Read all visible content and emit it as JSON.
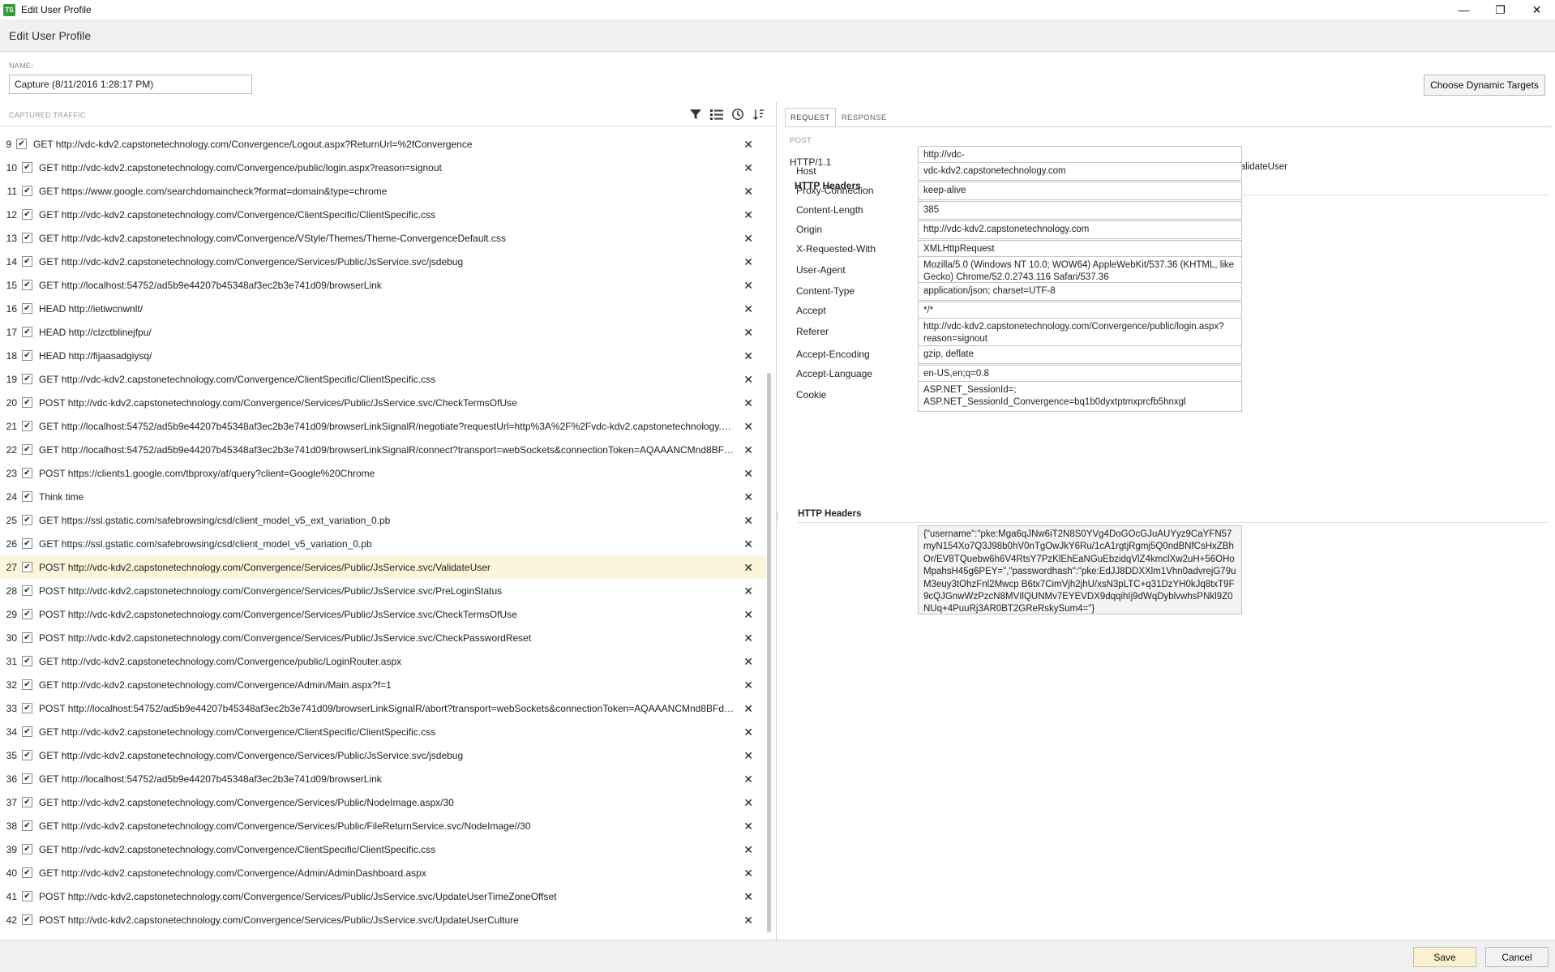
{
  "window": {
    "app_icon": "TS",
    "title": "Edit User Profile",
    "minimize_glyph": "—",
    "maximize_glyph": "❐",
    "close_glyph": "✕"
  },
  "header": {
    "title": "Edit User Profile"
  },
  "name": {
    "label": "NAME:",
    "value": "Capture (8/11/2016 1:28:17 PM)"
  },
  "dynamic_targets_button": "Choose Dynamic Targets",
  "traffic": {
    "title": "CAPTURED TRAFFIC",
    "toolbar_icons": [
      "filter-icon",
      "list-icon",
      "history-icon",
      "sort-icon"
    ],
    "rows": [
      {
        "num": "9",
        "text": "GET http://vdc-kdv2.capstonetechnology.com/Convergence/Logout.aspx?ReturnUrl=%2fConvergence"
      },
      {
        "num": "10",
        "text": "GET http://vdc-kdv2.capstonetechnology.com/Convergence/public/login.aspx?reason=signout"
      },
      {
        "num": "11",
        "text": "GET https://www.google.com/searchdomaincheck?format=domain&type=chrome"
      },
      {
        "num": "12",
        "text": "GET http://vdc-kdv2.capstonetechnology.com/Convergence/ClientSpecific/ClientSpecific.css"
      },
      {
        "num": "13",
        "text": "GET http://vdc-kdv2.capstonetechnology.com/Convergence/VStyle/Themes/Theme-ConvergenceDefault.css"
      },
      {
        "num": "14",
        "text": "GET http://vdc-kdv2.capstonetechnology.com/Convergence/Services/Public/JsService.svc/jsdebug"
      },
      {
        "num": "15",
        "text": "GET http://localhost:54752/ad5b9e44207b45348af3ec2b3e741d09/browserLink"
      },
      {
        "num": "16",
        "text": "HEAD http://ietiwcnwnlt/"
      },
      {
        "num": "17",
        "text": "HEAD http://clzctblinejfpu/"
      },
      {
        "num": "18",
        "text": "HEAD http://fijaasadgiysq/"
      },
      {
        "num": "19",
        "text": "GET http://vdc-kdv2.capstonetechnology.com/Convergence/ClientSpecific/ClientSpecific.css"
      },
      {
        "num": "20",
        "text": "POST http://vdc-kdv2.capstonetechnology.com/Convergence/Services/Public/JsService.svc/CheckTermsOfUse"
      },
      {
        "num": "21",
        "text": "GET http://localhost:54752/ad5b9e44207b45348af3ec2b3e741d09/browserLinkSignalR/negotiate?requestUrl=http%3A%2F%2Fvdc-kdv2.capstonetechnology.co..."
      },
      {
        "num": "22",
        "text": "GET http://localhost:54752/ad5b9e44207b45348af3ec2b3e741d09/browserLinkSignalR/connect?transport=webSockets&connectionToken=AQAAANCMnd8BFdE..."
      },
      {
        "num": "23",
        "text": "POST https://clients1.google.com/tbproxy/af/query?client=Google%20Chrome"
      },
      {
        "num": "24",
        "text": "Think time"
      },
      {
        "num": "25",
        "text": "GET https://ssl.gstatic.com/safebrowsing/csd/client_model_v5_ext_variation_0.pb"
      },
      {
        "num": "26",
        "text": "GET https://ssl.gstatic.com/safebrowsing/csd/client_model_v5_variation_0.pb"
      },
      {
        "num": "27",
        "text": "POST http://vdc-kdv2.capstonetechnology.com/Convergence/Services/Public/JsService.svc/ValidateUser"
      },
      {
        "num": "28",
        "text": "POST http://vdc-kdv2.capstonetechnology.com/Convergence/Services/Public/JsService.svc/PreLoginStatus"
      },
      {
        "num": "29",
        "text": "POST http://vdc-kdv2.capstonetechnology.com/Convergence/Services/Public/JsService.svc/CheckTermsOfUse"
      },
      {
        "num": "30",
        "text": "POST http://vdc-kdv2.capstonetechnology.com/Convergence/Services/Public/JsService.svc/CheckPasswordReset"
      },
      {
        "num": "31",
        "text": "GET http://vdc-kdv2.capstonetechnology.com/Convergence/public/LoginRouter.aspx"
      },
      {
        "num": "32",
        "text": "GET http://vdc-kdv2.capstonetechnology.com/Convergence/Admin/Main.aspx?f=1"
      },
      {
        "num": "33",
        "text": "POST http://localhost:54752/ad5b9e44207b45348af3ec2b3e741d09/browserLinkSignalR/abort?transport=webSockets&connectionToken=AQAAANCMnd8BFdER..."
      },
      {
        "num": "34",
        "text": "GET http://vdc-kdv2.capstonetechnology.com/Convergence/ClientSpecific/ClientSpecific.css"
      },
      {
        "num": "35",
        "text": "GET http://vdc-kdv2.capstonetechnology.com/Convergence/Services/Public/JsService.svc/jsdebug"
      },
      {
        "num": "36",
        "text": "GET http://localhost:54752/ad5b9e44207b45348af3ec2b3e741d09/browserLink"
      },
      {
        "num": "37",
        "text": "GET http://vdc-kdv2.capstonetechnology.com/Convergence/Services/Public/NodeImage.aspx/30"
      },
      {
        "num": "38",
        "text": "GET http://vdc-kdv2.capstonetechnology.com/Convergence/Services/Public/FileReturnService.svc/NodeImage//30"
      },
      {
        "num": "39",
        "text": "GET http://vdc-kdv2.capstonetechnology.com/Convergence/ClientSpecific/ClientSpecific.css"
      },
      {
        "num": "40",
        "text": "GET http://vdc-kdv2.capstonetechnology.com/Convergence/Admin/AdminDashboard.aspx"
      },
      {
        "num": "41",
        "text": "POST http://vdc-kdv2.capstonetechnology.com/Convergence/Services/Public/JsService.svc/UpdateUserTimeZoneOffset"
      },
      {
        "num": "42",
        "text": "POST http://vdc-kdv2.capstonetechnology.com/Convergence/Services/Public/JsService.svc/UpdateUserCulture"
      }
    ],
    "selected_num": "27"
  },
  "request": {
    "tabs": [
      "REQUEST",
      "RESPONSE"
    ],
    "method": "POST",
    "http_version": "HTTP/1.1",
    "url": "http://vdc-kdv2.capstonetechnology.com/Convergence/Services/Public/JsService.svc/ValidateUser",
    "headers_title": "HTTP Headers",
    "headers": [
      {
        "name": "Host",
        "value": "vdc-kdv2.capstonetechnology.com"
      },
      {
        "name": "Proxy-Connection",
        "value": "keep-alive"
      },
      {
        "name": "Content-Length",
        "value": "385"
      },
      {
        "name": "Origin",
        "value": "http://vdc-kdv2.capstonetechnology.com"
      },
      {
        "name": "X-Requested-With",
        "value": "XMLHttpRequest"
      },
      {
        "name": "User-Agent",
        "value": "Mozilla/5.0 (Windows NT 10.0; WOW64) AppleWebKit/537.36 (KHTML, like Gecko) Chrome/52.0.2743.116 Safari/537.36"
      },
      {
        "name": "Content-Type",
        "value": "application/json; charset=UTF-8"
      },
      {
        "name": "Accept",
        "value": "*/*"
      },
      {
        "name": "Referer",
        "value": "http://vdc-kdv2.capstonetechnology.com/Convergence/public/login.aspx?reason=signout"
      },
      {
        "name": "Accept-Encoding",
        "value": "gzip, deflate"
      },
      {
        "name": "Accept-Language",
        "value": "en-US,en;q=0.8"
      },
      {
        "name": "Cookie",
        "value": "ASP.NET_SessionId=; ASP.NET_SessionId_Convergence=bq1b0dyxtptmxprcfb5hnxgl"
      }
    ],
    "body_title": "HTTP Headers",
    "body": "{\"username\":\"pke:Mga6qJNw6iT2N8S0YVg4DoGOcGJuAUYyz9CaYFN57myN154Xo7Q3J98b0hV0nTgOwJkY6Ru/1cA1rgtjRgmj5Q0ndBNfCsHxZBhOr/EV8TQuebw6h6V4RtsY7PzKlEhEaNGuEbzidqVlZ4kmclXw2uH+56OHoMpahsH45g6PEY=\",\"passwordhash\":\"pke:EdJJ8DDXXlm1Vhn0advrejG79uM3euy3tOhzFnl2Mwcp B6tx7CimVjh2jhU/xsN3pLTC+q31DzYH0kJq8txT9F9cQJGnwWzPzcN8MVIlQUNMv7EYEVDX9dqqihIj9dWqDyblvwhsPNkl9Z0NUq+4PuuRj3AR0BT2GReRskySum4=\"}"
  },
  "footer": {
    "save": "Save",
    "cancel": "Cancel"
  }
}
